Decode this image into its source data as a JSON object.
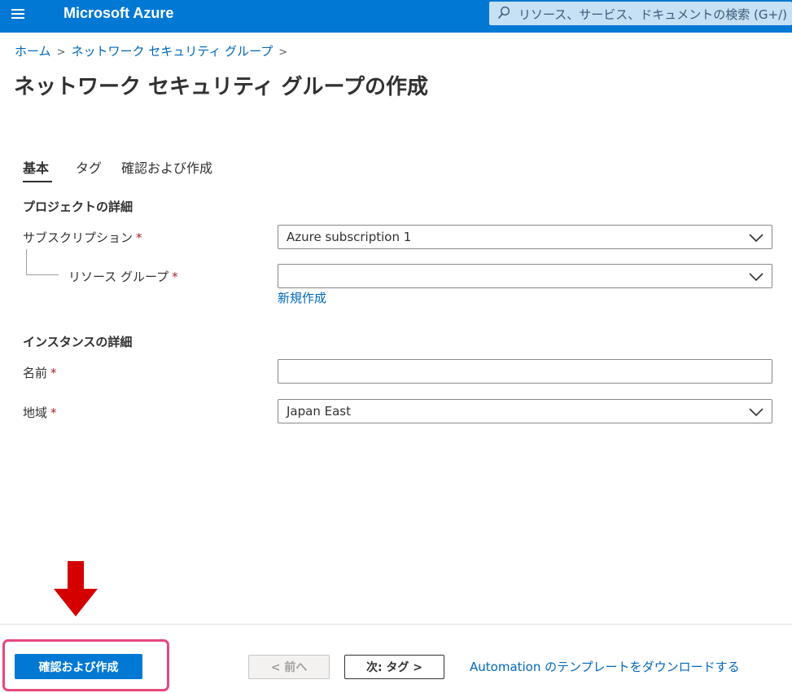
{
  "header": {
    "app_title": "Microsoft Azure",
    "menu_icon": "hamburger-menu-icon",
    "search_icon": "search-icon",
    "search_placeholder": "リソース、サービス、ドキュメントの検索 (G+/)"
  },
  "breadcrumb": {
    "items": [
      "ホーム",
      "ネットワーク セキュリティ グループ"
    ]
  },
  "page": {
    "title": "ネットワーク セキュリティ グループの作成",
    "more_label": "…"
  },
  "tabs": [
    {
      "label": "基本",
      "active": true
    },
    {
      "label": "タグ",
      "active": false
    },
    {
      "label": "確認および作成",
      "active": false
    }
  ],
  "project": {
    "section_title": "プロジェクトの詳細",
    "subscription_label": "サブスクリプション",
    "subscription_value": "Azure subscription 1",
    "resource_group_label": "リソース グループ",
    "resource_group_value": "",
    "create_new_link": "新規作成"
  },
  "instance": {
    "section_title": "インスタンスの詳細",
    "name_label": "名前",
    "name_value": "",
    "region_label": "地域",
    "region_value": "Japan East"
  },
  "required_marker": "*",
  "footer": {
    "review_create_label": "確認および作成",
    "prev_label": "< 前へ",
    "next_label": "次: タグ >",
    "download_link": "Automation のテンプレートをダウンロードする"
  },
  "colors": {
    "brand_blue": "#0078d4",
    "link_blue": "#0067b8",
    "required_red": "#a4262c",
    "annotation_arrow": "#d40000",
    "annotation_highlight": "#e8487a"
  }
}
